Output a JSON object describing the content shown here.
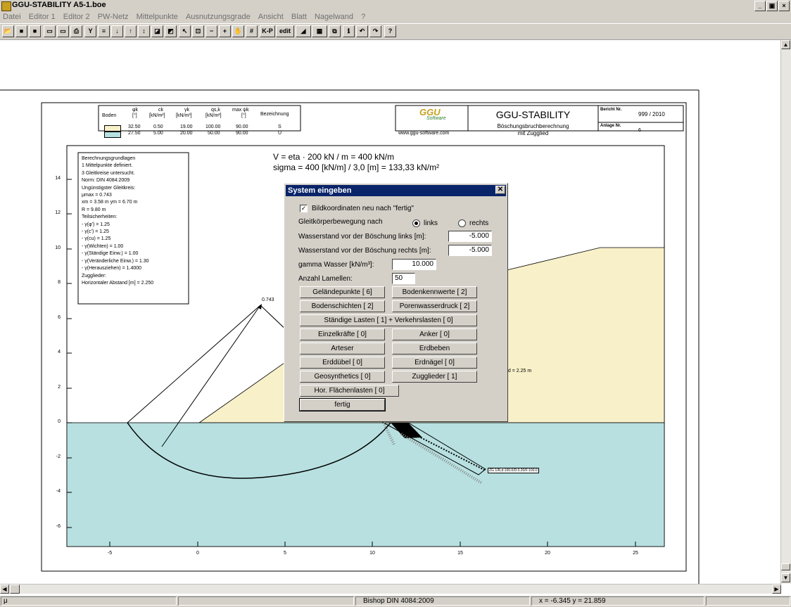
{
  "window": {
    "title": "GGU-STABILITY A5-1.boe",
    "controls": [
      "_",
      "▣",
      "×"
    ]
  },
  "menu": [
    "Datei",
    "Editor 1",
    "Editor 2",
    "PW-Netz",
    "Mittelpunkte",
    "Ausnutzungsgrade",
    "Ansicht",
    "Blatt",
    "Nagelwand",
    "?"
  ],
  "toolbar": {
    "kp_label": "K-P",
    "edit_label": "edit",
    "help_label": "?"
  },
  "header": {
    "legend": {
      "boden_label": "Boden",
      "col_phi": "φk",
      "col_phi_unit": "[°]",
      "col_c": "ck",
      "col_c_unit": "[kN/m²]",
      "col_gamma": "γk",
      "col_gamma_unit": "[kN/m³]",
      "col_q": "qs,k",
      "col_q_unit": "[kN/m²]",
      "col_psi": "max ψk",
      "col_psi_unit": "[°]",
      "col_bez": "Bezeichnung",
      "rows": [
        {
          "color": "#f8f0c8",
          "phi": "32.50",
          "c": "0.50",
          "gamma": "19.00",
          "q": "100.00",
          "psi": "90.00",
          "bez": "S"
        },
        {
          "color": "#b8e0e0",
          "phi": "27.50",
          "c": "5.00",
          "gamma": "20.00",
          "q": "50.00",
          "psi": "90.00",
          "bez": "U"
        }
      ]
    },
    "logo_text": "GGU",
    "logo_sub": "Software",
    "website": "www.ggu-software.com",
    "app_name": "GGU-STABILITY",
    "subtitle1": "Böschungsbruchberechnung",
    "subtitle2": "mit Zugglied",
    "bericht_label": "Bericht Nr.",
    "bericht_value": "999 / 2010",
    "anlage_label": "Anlage Nr.",
    "anlage_value": "6"
  },
  "plot": {
    "formula1": "V = eta · 200 kN / m = 400 kN/m",
    "formula2": "sigma = 400 [kN/m] / 3,0 [m] = 133,33 kN/m²",
    "info_lines": [
      "Berechnungsgrundlagen",
      "1 Mittelpunkte definiert.",
      "3 Gleitkreise untersucht.",
      "Norm:  DIN 4084:2009",
      "Ungünstigster Gleitkreis:",
      "μmax = 0.743",
      "xm = 3.58 m   ym = 6.70 m",
      "R = 9.80 m",
      "Teilsicherheiten:",
      " - γ(φ') = 1.25",
      " - γ(c') = 1.25",
      " - γ(cu) = 1.25",
      " - γ(Wichten) = 1.00",
      " - γ(Ständige Einw.) = 1.00",
      " - γ(Veränderliche Einw.) = 1.30",
      " - γ(Herausziehen) = 1.4000",
      "Zugglieder:",
      "Horizontaler Abstand [m] = 2.250"
    ],
    "mu_label": "0.743",
    "abstand_label": "nd = 2.25 m",
    "zugglied_label": "ZG 1/R,d:100.0/D:0.20/F:100.0",
    "y_ticks": [
      "14",
      "12",
      "10",
      "8",
      "6",
      "4",
      "2",
      "0",
      "-2",
      "-4",
      "-6"
    ],
    "x_ticks": [
      "-5",
      "0",
      "5",
      "10",
      "15",
      "20",
      "25"
    ],
    "colors": {
      "soil_s": "#f8f0c8",
      "soil_u": "#b8e0e0"
    }
  },
  "dialog": {
    "title": "System eingeben",
    "checkbox_label": "Bildkoordinaten neu nach \"fertig\"",
    "checkbox_checked": true,
    "direction_label": "Gleitkörperbewegung nach",
    "radio_links": "links",
    "radio_rechts": "rechts",
    "selected_direction": "links",
    "ws_links_label": "Wasserstand vor der Böschung links [m]:",
    "ws_links_value": "-5.000",
    "ws_rechts_label": "Wasserstand vor der Böschung rechts [m]:",
    "ws_rechts_value": "-5.000",
    "gamma_label": "gamma Wasser [kN/m³]:",
    "gamma_value": "10.000",
    "lamellen_label": "Anzahl Lamellen:",
    "lamellen_value": "50",
    "buttons": {
      "gelaendepunkte": "Geländepunkte [ 6]",
      "bodenkennwerte": "Bodenkennwerte [ 2]",
      "bodenschichten": "Bodenschichten [ 2]",
      "porenwasserdruck": "Porenwasserdruck [ 2]",
      "lasten": "Ständige Lasten [ 1] + Verkehrslasten [ 0]",
      "einzelkraefte": "Einzelkräfte [ 0]",
      "anker": "Anker [ 0]",
      "arteser": "Arteser",
      "erdbeben": "Erdbeben",
      "erdduebel": "Erddübel [ 0]",
      "erdnaegel": "Erdnägel [ 0]",
      "geosynthetics": "Geosynthetics [ 0]",
      "zugglieder": "Zugglieder [ 1]",
      "hor_flaechenlasten": "Hor. Flächenlasten  [ 0]",
      "fertig": "fertig"
    }
  },
  "status": {
    "mode": "μ",
    "method": "Bishop  DIN 4084:2009",
    "coords": "x = -6.345 y = 21.859"
  }
}
